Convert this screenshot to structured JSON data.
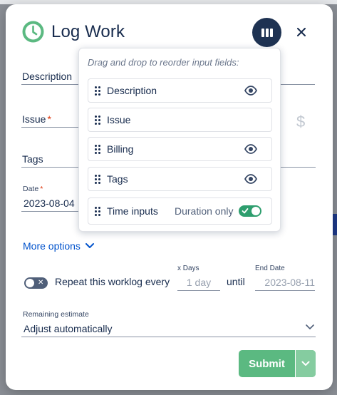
{
  "modal": {
    "title": "Log Work",
    "close_glyph": "×",
    "icons": {
      "clock": "clock-icon",
      "layout": "columns-icon",
      "close": "close-icon"
    },
    "colors": {
      "clock": "#5bb981",
      "layout_button": "#1e3252",
      "submit": "#5bb981",
      "link": "#0052cc"
    }
  },
  "form": {
    "description_label": "Description",
    "issue_label": "Issue",
    "issue_required": "*",
    "billing_symbol": "$",
    "tags_label": "Tags",
    "date_label": "Date",
    "date_required": "*",
    "date_value": "2023-08-04",
    "more_options": "More options",
    "repeat_text": "Repeat this worklog every",
    "repeat_toggle_glyph": "✕",
    "xdays_label": "x Days",
    "days_placeholder": "1 day",
    "until": "until",
    "end_date_label": "End Date",
    "end_date_value": "2023-08-11",
    "remaining_label": "Remaining estimate",
    "remaining_value": "Adjust automatically",
    "submit_label": "Submit"
  },
  "popover": {
    "hint": "Drag and drop to reorder input fields:",
    "rows": [
      {
        "label": "Description",
        "visibility": "visible"
      },
      {
        "label": "Issue"
      },
      {
        "label": "Billing",
        "visibility": "visible"
      },
      {
        "label": "Tags",
        "visibility": "visible"
      },
      {
        "label": "Time inputs",
        "extra": "Duration only",
        "toggle": true
      }
    ]
  }
}
